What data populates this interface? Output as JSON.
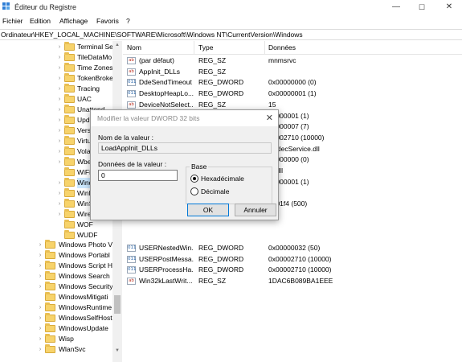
{
  "window": {
    "title": "Éditeur du Registre",
    "minimize": "—",
    "maximize": "☐",
    "close": "✕"
  },
  "menu": [
    "Fichier",
    "Edition",
    "Affichage",
    "Favoris",
    "?"
  ],
  "address": "Ordinateur\\HKEY_LOCAL_MACHINE\\SOFTWARE\\Microsoft\\Windows NT\\CurrentVersion\\Windows",
  "tree": {
    "inner": [
      {
        "label": "Terminal Se",
        "chev": "›"
      },
      {
        "label": "TileDataMo",
        "chev": "›"
      },
      {
        "label": "Time Zones",
        "chev": "›"
      },
      {
        "label": "TokenBroke",
        "chev": "›"
      },
      {
        "label": "Tracing",
        "chev": "›"
      },
      {
        "label": "UAC",
        "chev": "›"
      },
      {
        "label": "Unattend",
        "chev": "›"
      },
      {
        "label": "Upda",
        "chev": "›"
      },
      {
        "label": "Versi",
        "chev": "›"
      },
      {
        "label": "Virtu",
        "chev": "›"
      },
      {
        "label": "Volat",
        "chev": "›"
      },
      {
        "label": "Wbe",
        "chev": "›"
      },
      {
        "label": "WiFi",
        "chev": ""
      },
      {
        "label": "Wind",
        "chev": "›"
      },
      {
        "label": "Winl",
        "chev": "›"
      },
      {
        "label": "WinS",
        "chev": "›"
      },
      {
        "label": "Wire",
        "chev": "›"
      },
      {
        "label": "WOF",
        "chev": ""
      },
      {
        "label": "WUDF",
        "chev": ""
      }
    ],
    "outer": [
      {
        "label": "Windows Photo V",
        "chev": "›"
      },
      {
        "label": "Windows Portabl",
        "chev": "›"
      },
      {
        "label": "Windows Script H",
        "chev": "›"
      },
      {
        "label": "Windows Search",
        "chev": "›"
      },
      {
        "label": "Windows Security",
        "chev": "›"
      },
      {
        "label": "WindowsMitigati",
        "chev": ""
      },
      {
        "label": "WindowsRuntime",
        "chev": "›"
      },
      {
        "label": "WindowsSelfHost",
        "chev": "›"
      },
      {
        "label": "WindowsUpdate",
        "chev": "›"
      },
      {
        "label": "Wisp",
        "chev": "›"
      },
      {
        "label": "WlanSvc",
        "chev": "›"
      }
    ]
  },
  "list": {
    "headers": [
      "Nom",
      "Type",
      "Données"
    ],
    "rows": [
      {
        "icon": "ab",
        "kind": "sz",
        "name": "(par défaut)",
        "type": "REG_SZ",
        "data": "mnmsrvc"
      },
      {
        "icon": "ab",
        "kind": "sz",
        "name": "AppInit_DLLs",
        "type": "REG_SZ",
        "data": ""
      },
      {
        "icon": "011",
        "kind": "bin",
        "name": "DdeSendTimeout",
        "type": "REG_DWORD",
        "data": "0x00000000 (0)"
      },
      {
        "icon": "011",
        "kind": "bin",
        "name": "DesktopHeapLo...",
        "type": "REG_DWORD",
        "data": "0x00000001 (1)"
      },
      {
        "icon": "ab",
        "kind": "sz",
        "name": "DeviceNotSelect...",
        "type": "REG_SZ",
        "data": "15"
      },
      {
        "icon": "",
        "kind": "",
        "name": "",
        "type": "",
        "data": "00000001 (1)"
      },
      {
        "icon": "",
        "kind": "",
        "name": "",
        "type": "",
        "data": "00000007 (7)"
      },
      {
        "icon": "",
        "kind": "",
        "name": "",
        "type": "",
        "data": "00002710 (10000)"
      },
      {
        "icon": "",
        "kind": "",
        "name": "",
        "type": "",
        "data": "CodecService.dll"
      },
      {
        "icon": "",
        "kind": "",
        "name": "",
        "type": "",
        "data": "00000000 (0)"
      },
      {
        "icon": "",
        "kind": "",
        "name": "",
        "type": "",
        "data": "ut.dll"
      },
      {
        "icon": "",
        "kind": "",
        "name": "",
        "type": "",
        "data": "00000001 (1)"
      },
      {
        "icon": "",
        "kind": "",
        "name": "",
        "type": "",
        "data": ""
      },
      {
        "icon": "",
        "kind": "",
        "name": "",
        "type": "",
        "data": "0001f4 (500)"
      },
      {
        "icon": "",
        "kind": "",
        "name": "",
        "type": "",
        "data": ""
      },
      {
        "icon": "",
        "kind": "",
        "name": "",
        "type": "",
        "data": ""
      },
      {
        "icon": "",
        "kind": "",
        "name": "",
        "type": "",
        "data": ""
      },
      {
        "icon": "011",
        "kind": "bin",
        "name": "USERNestedWin...",
        "type": "REG_DWORD",
        "data": "0x00000032 (50)"
      },
      {
        "icon": "011",
        "kind": "bin",
        "name": "USERPostMessa...",
        "type": "REG_DWORD",
        "data": "0x00002710 (10000)"
      },
      {
        "icon": "011",
        "kind": "bin",
        "name": "USERProcessHa...",
        "type": "REG_DWORD",
        "data": "0x00002710 (10000)"
      },
      {
        "icon": "ab",
        "kind": "sz",
        "name": "Win32kLastWrit...",
        "type": "REG_SZ",
        "data": "1DAC6B089BA1EEE"
      }
    ]
  },
  "dialog": {
    "title": "Modifier la valeur DWORD 32 bits",
    "close": "✕",
    "name_label": "Nom de la valeur :",
    "name_value": "LoadAppInit_DLLs",
    "data_label": "Données de la valeur :",
    "data_value": "0",
    "base_label": "Base",
    "hex_label": "Hexadécimale",
    "dec_label": "Décimale",
    "ok_label": "OK",
    "cancel_label": "Annuler"
  }
}
